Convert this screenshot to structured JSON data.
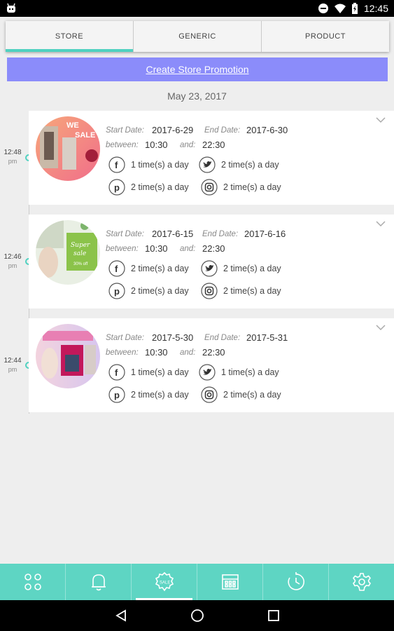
{
  "status_bar": {
    "time": "12:45"
  },
  "tabs": [
    {
      "label": "STORE",
      "active": true
    },
    {
      "label": "GENERIC",
      "active": false
    },
    {
      "label": "PRODUCT",
      "active": false
    }
  ],
  "create_promotion": {
    "label": "Create Store Promotion"
  },
  "date_header": "May 23, 2017",
  "labels": {
    "start_date": "Start Date:",
    "end_date": "End Date:",
    "between": "between:",
    "and": "and:"
  },
  "promotions": [
    {
      "time": "12:48",
      "ampm": "pm",
      "start_date": "2017-6-29",
      "end_date": "2017-6-30",
      "between": "10:30",
      "and": "22:30",
      "facebook": "1 time(s) a day",
      "twitter": "2 time(s) a day",
      "pinterest": "2 time(s) a day",
      "instagram": "2 time(s) a day"
    },
    {
      "time": "12:46",
      "ampm": "pm",
      "start_date": "2017-6-15",
      "end_date": "2017-6-16",
      "between": "10:30",
      "and": "22:30",
      "facebook": "2 time(s) a day",
      "twitter": "2 time(s) a day",
      "pinterest": "2 time(s) a day",
      "instagram": "2 time(s) a day"
    },
    {
      "time": "12:44",
      "ampm": "pm",
      "start_date": "2017-5-30",
      "end_date": "2017-5-31",
      "between": "10:30",
      "and": "22:30",
      "facebook": "1 time(s) a day",
      "twitter": "1 time(s) a day",
      "pinterest": "2 time(s) a day",
      "instagram": "2 time(s) a day"
    }
  ],
  "bottom_nav": [
    {
      "icon": "grid-icon",
      "active": false
    },
    {
      "icon": "bell-icon",
      "active": false
    },
    {
      "icon": "sale-icon",
      "active": true,
      "badge_text": "SALE"
    },
    {
      "icon": "calendar-icon",
      "active": false
    },
    {
      "icon": "history-icon",
      "active": false
    },
    {
      "icon": "gear-icon",
      "active": false
    }
  ],
  "colors": {
    "accent": "#5ed5c3",
    "tab_indicator": "#4fd1c0",
    "create_button": "#8b8cfa"
  }
}
